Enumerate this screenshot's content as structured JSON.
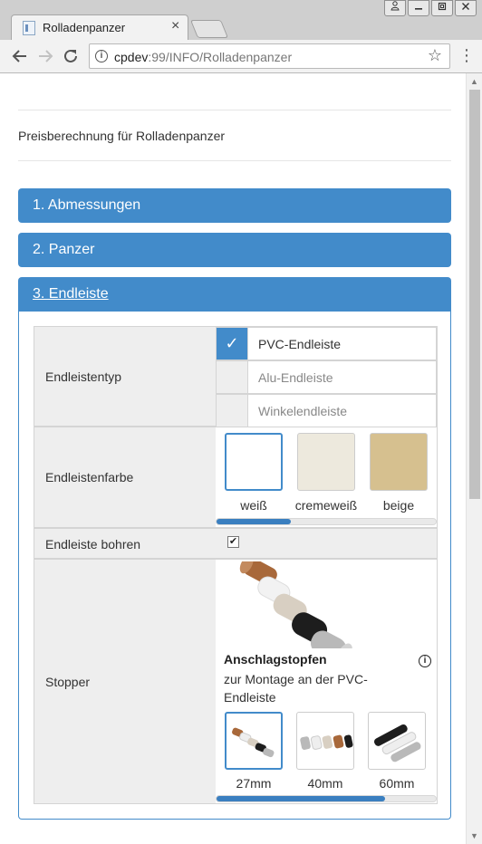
{
  "browser": {
    "tab_title": "Rolladenpanzer",
    "tab_close": "×",
    "url_host": "cpdev",
    "url_rest": ":99/INFO/Rolladenpanzer",
    "window_buttons": [
      "user-icon",
      "minimize-icon",
      "maximize-icon",
      "close-icon"
    ],
    "nav_icons": [
      "back-arrow-icon",
      "forward-arrow-icon",
      "reload-icon"
    ]
  },
  "page": {
    "heading": "Preisberechnung für Rolladenpanzer",
    "sections": [
      {
        "label": "1. Abmessungen"
      },
      {
        "label": "2. Panzer"
      },
      {
        "label": "3. Endleiste"
      }
    ],
    "accent_color": "#428bca"
  },
  "endleistentyp": {
    "label": "Endleistentyp",
    "options": [
      {
        "label": "PVC-Endleiste",
        "selected": true
      },
      {
        "label": "Alu-Endleiste",
        "selected": false
      },
      {
        "label": "Winkelendleiste",
        "selected": false
      }
    ],
    "check_glyph": "✓"
  },
  "endleistenfarbe": {
    "label": "Endleistenfarbe",
    "options": [
      {
        "label": "weiß",
        "color": "#ffffff",
        "selected": true
      },
      {
        "label": "cremeweiß",
        "color": "#ede9dd",
        "selected": false
      },
      {
        "label": "beige",
        "color": "#d6c08f",
        "selected": false
      }
    ],
    "scroll_fraction": 0.34
  },
  "bohren": {
    "label": "Endleiste bohren",
    "checked": true,
    "check_glyph": "✔"
  },
  "stopper": {
    "label": "Stopper",
    "product_title": "Anschlagstopfen",
    "product_desc": "zur Montage an der PVC-Endleiste",
    "info_glyph": "i",
    "sizes": [
      {
        "label": "27mm",
        "selected": true
      },
      {
        "label": "40mm",
        "selected": false
      },
      {
        "label": "60mm",
        "selected": false
      }
    ],
    "scroll_fraction": 0.77
  }
}
